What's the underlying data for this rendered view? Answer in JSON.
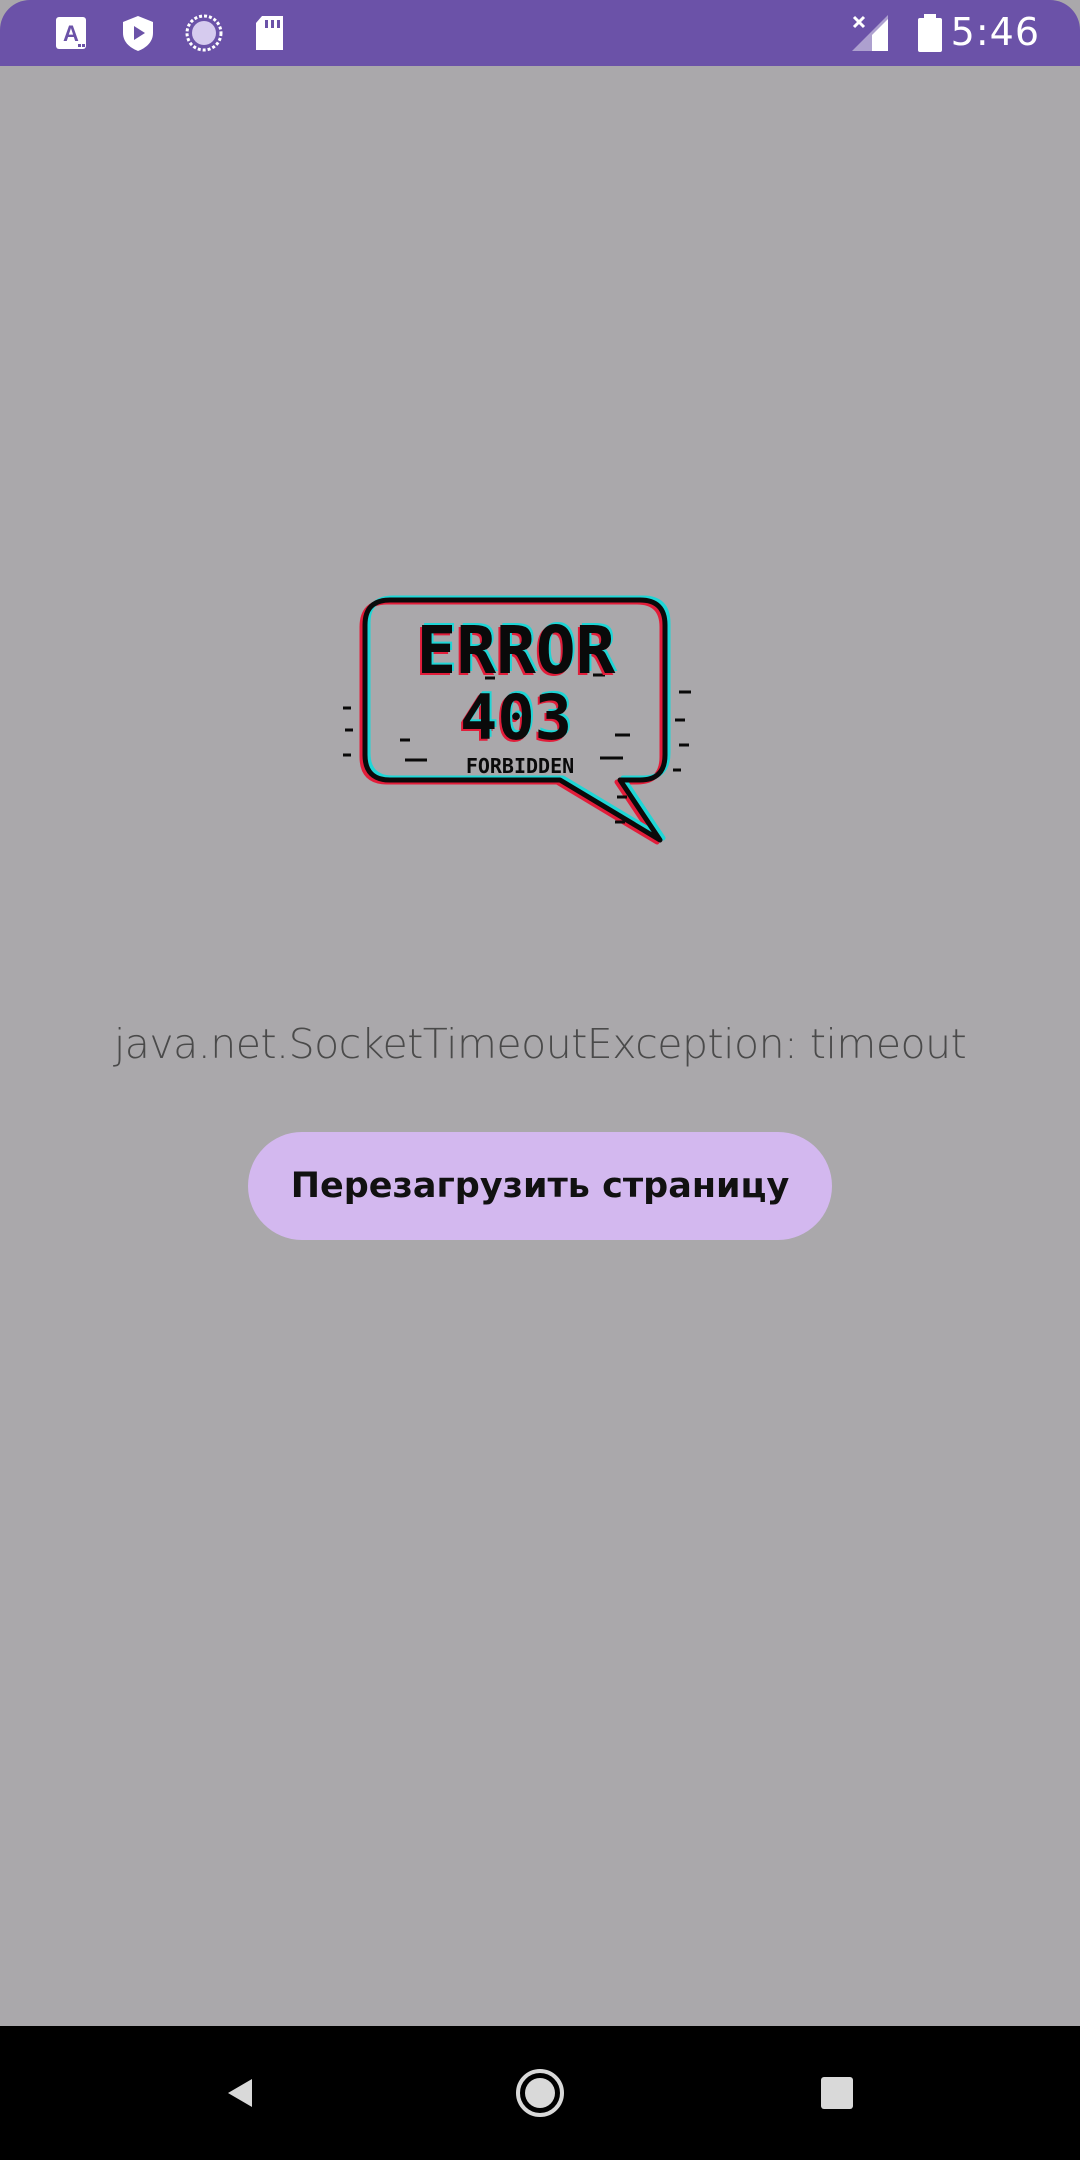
{
  "status_bar": {
    "time": "5:46",
    "color": "#6b52a8",
    "icons": [
      "a-icon",
      "shield-play-icon",
      "loading-circle-icon",
      "sd-card-icon",
      "no-signal-icon",
      "battery-icon"
    ]
  },
  "main": {
    "background": "#aaa8ab",
    "illustration": {
      "line1": "ERROR",
      "line2": "403",
      "line3": "FORBIDDEN"
    },
    "error_message": "java.net.SocketTimeoutException: timeout",
    "reload_button_label": "Перезагрузить страницу",
    "accent": "#d3b8ef"
  },
  "nav_bar": {
    "icons": [
      "back-icon",
      "home-icon",
      "recents-icon"
    ]
  }
}
